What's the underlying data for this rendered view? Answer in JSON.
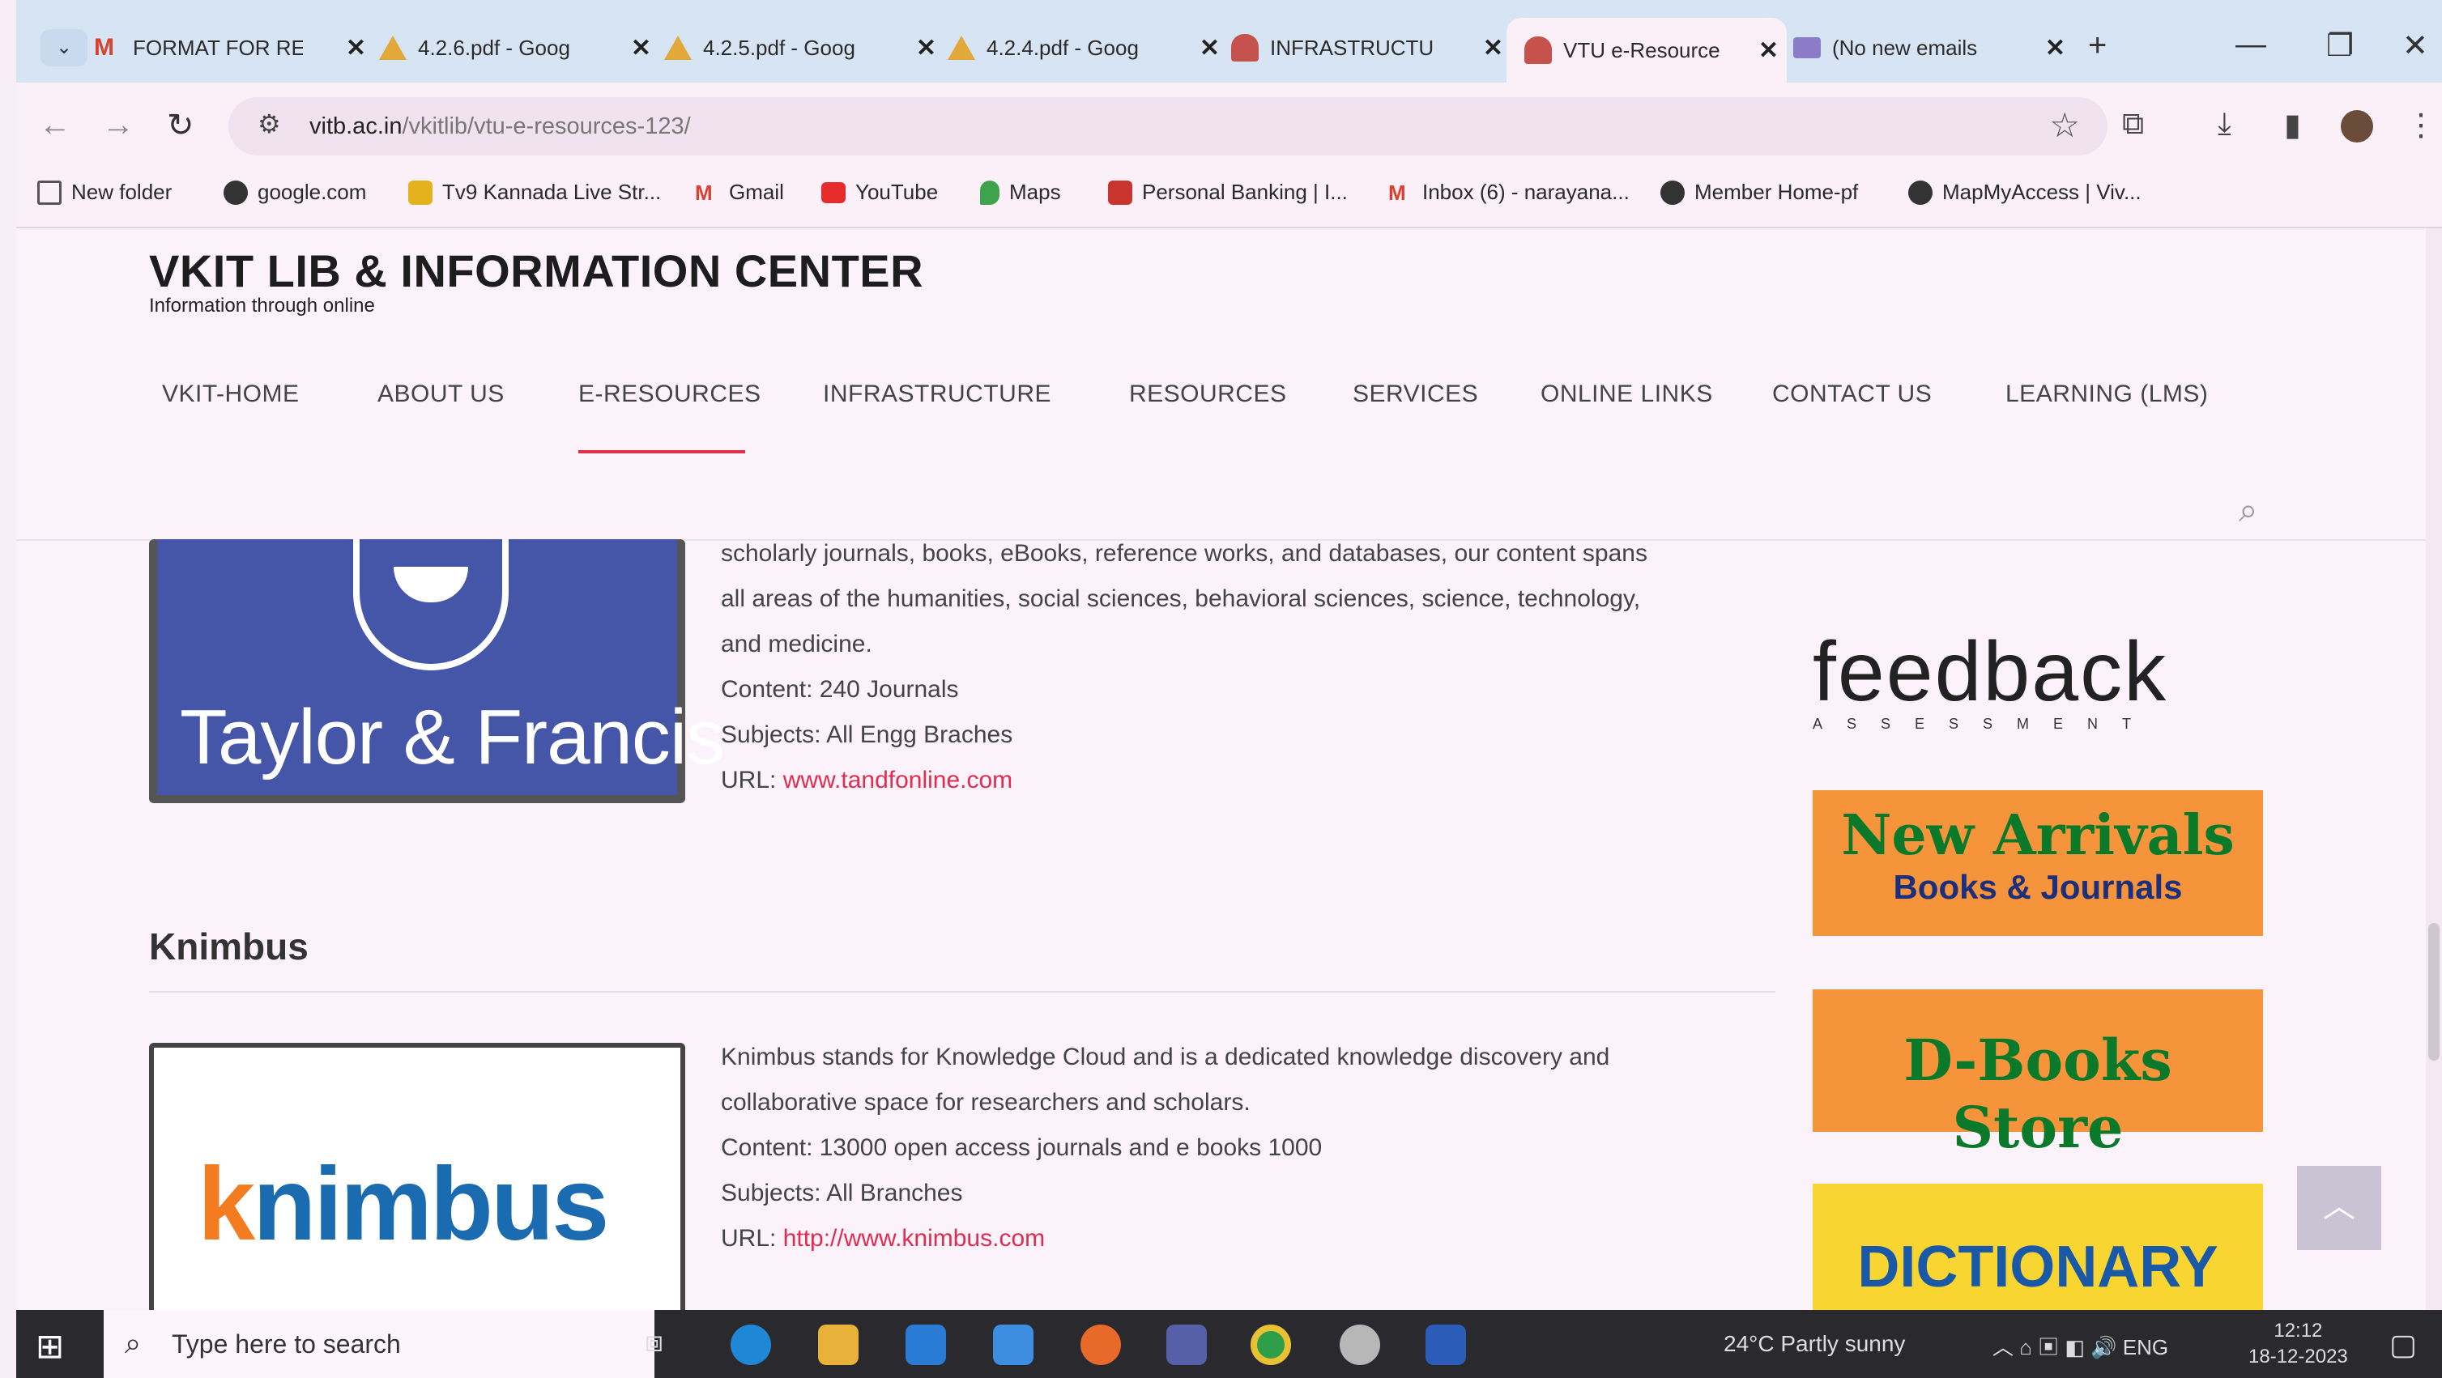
{
  "browser": {
    "tabs": [
      {
        "label": "FORMAT FOR RE",
        "icon": "gmail-icon"
      },
      {
        "label": "4.2.6.pdf - Goog",
        "icon": "drive-icon"
      },
      {
        "label": "4.2.5.pdf - Goog",
        "icon": "drive-icon"
      },
      {
        "label": "4.2.4.pdf - Goog",
        "icon": "drive-icon"
      },
      {
        "label": "INFRASTRUCTU",
        "icon": "site-icon"
      },
      {
        "label": "VTU e-Resource",
        "icon": "site-icon"
      },
      {
        "label": "(No new emails",
        "icon": "mail-icon"
      }
    ],
    "active_tab": 5,
    "url_host": "vitb.ac.in",
    "url_path": "/vkitlib/vtu-e-resources-123/",
    "bookmarks": [
      "New folder",
      "google.com",
      "Tv9 Kannada Live Str...",
      "Gmail",
      "YouTube",
      "Maps",
      "Personal Banking | I...",
      "Inbox (6) - narayana...",
      "Member Home-pf",
      "MapMyAccess | Viv..."
    ]
  },
  "site": {
    "title": "VKIT LIB & INFORMATION CENTER",
    "tagline": "Information through online",
    "menu": [
      "VKIT-HOME",
      "ABOUT US",
      "E-RESOURCES",
      "INFRASTRUCTURE",
      "RESOURCES",
      "SERVICES",
      "ONLINE LINKS",
      "CONTACT US",
      "LEARNING (LMS)"
    ],
    "active_menu": "E-RESOURCES"
  },
  "resources": [
    {
      "logo_text": "Taylor & Francis",
      "desc_lines": [
        "scholarly journals, books, eBooks, reference works, and databases, our content spans",
        "all areas of the humanities, social sciences, behavioral sciences, science, technology,",
        "and medicine."
      ],
      "content": "Content: 240 Journals",
      "subjects": "Subjects: All Engg Braches",
      "url_label": "URL: ",
      "url": "www.tandfonline.com"
    },
    {
      "heading": "Knimbus",
      "logo_k": "k",
      "logo_rest": "nimbus",
      "desc_lines": [
        "Knimbus stands for Knowledge Cloud and is a dedicated knowledge discovery and",
        "collaborative space for researchers and scholars."
      ],
      "content": "Content: 13000 open access journals and e books 1000",
      "subjects": "Subjects: All Branches",
      "url_label": "URL: ",
      "url": "http://www.knimbus.com"
    }
  ],
  "sidebar": {
    "feedback": "feedback",
    "feedback_sub": "ASSESSMENT",
    "new_arrivals": "New Arrivals",
    "new_arrivals_sub": "Books & Journals",
    "dbooks": "D-Books Store",
    "dictionary": "DICTIONARY"
  },
  "taskbar": {
    "search_placeholder": "Type here to search",
    "weather": "24°C  Partly sunny",
    "lang": "ENG",
    "time": "12:12",
    "date": "18-12-2023"
  },
  "colors": {
    "accent": "#e0304a",
    "tf_blue": "#4555a8",
    "orange": "#f5943b",
    "yellow": "#f8d530"
  }
}
